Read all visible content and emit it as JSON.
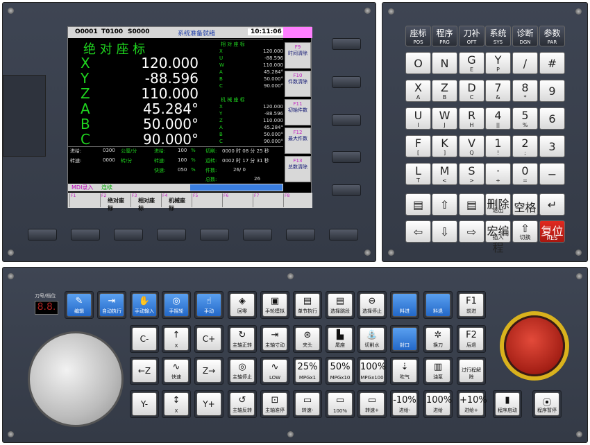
{
  "screen": {
    "program": "O0001",
    "tool": "T0100",
    "speed_cmd": "S0000",
    "status": "系统准备就绪",
    "time": "10:11:06",
    "abs_title": "绝 对 座 标",
    "axes": [
      {
        "name": "X",
        "value": "120.000"
      },
      {
        "name": "Y",
        "value": "-88.596"
      },
      {
        "name": "Z",
        "value": "110.000"
      },
      {
        "name": "A",
        "value": "45.284°"
      },
      {
        "name": "B",
        "value": "50.000°"
      },
      {
        "name": "C",
        "value": "90.000°"
      }
    ],
    "rel_title": "相 对 座 标",
    "rel": [
      {
        "name": "X",
        "value": "120.000"
      },
      {
        "name": "U",
        "value": "-88.596"
      },
      {
        "name": "W",
        "value": "110.000"
      },
      {
        "name": "A",
        "value": "45.284°"
      },
      {
        "name": "B",
        "value": "50.000°"
      },
      {
        "name": "C",
        "value": "90.000°"
      }
    ],
    "mach_title": "机 械 座 标",
    "mach": [
      {
        "name": "X",
        "value": "120.000"
      },
      {
        "name": "Y",
        "value": "-88.596"
      },
      {
        "name": "Z",
        "value": "110.000"
      },
      {
        "name": "A",
        "value": "45.284°"
      },
      {
        "name": "B",
        "value": "50.000°"
      },
      {
        "name": "C",
        "value": "90.000°"
      }
    ],
    "feed_label": "进给:",
    "feed_val": "0300",
    "feed_unit": "公厘/分",
    "feed_pct_label": "进给:",
    "feed_pct": "100",
    "rapid_label": "快速:",
    "rapid_pct": "050",
    "spin_label": "转速:",
    "spin_val": "0000",
    "spin_unit": "转/分",
    "spin_pct_label": "转速:",
    "spin_pct": "100",
    "cut_label": "切削:",
    "cut_time": "0000 时 08 分 25 秒",
    "run_label": "运转:",
    "run_time": "0002 时 17 分 31 秒",
    "parts_label": "件数:",
    "parts": "26/ 0",
    "total_label": "总数:",
    "total": "26",
    "mode": "MDI录入",
    "mode2": "连续",
    "fkeys": [
      {
        "n": "F9",
        "l": "时间清除"
      },
      {
        "n": "F10",
        "l": "件数清除"
      },
      {
        "n": "F11",
        "l": "初始件数"
      },
      {
        "n": "F12",
        "l": "最大件数"
      },
      {
        "n": "F13",
        "l": "总数清除"
      }
    ],
    "bottom_tabs": [
      {
        "n": "F1",
        "l": ""
      },
      {
        "n": "F2",
        "l": "绝对座标"
      },
      {
        "n": "F3",
        "l": "相对座标"
      },
      {
        "n": "F4",
        "l": "机械座标"
      },
      {
        "n": "F5",
        "l": ""
      },
      {
        "n": "F6",
        "l": ""
      },
      {
        "n": "F7",
        "l": ""
      },
      {
        "n": "F8",
        "l": ""
      }
    ]
  },
  "keypad": {
    "top": [
      {
        "a": "座标",
        "b": "POS"
      },
      {
        "a": "程序",
        "b": "PRG"
      },
      {
        "a": "刀补",
        "b": "OFT"
      },
      {
        "a": "系统",
        "b": "SYS"
      },
      {
        "a": "诊断",
        "b": "DGN"
      },
      {
        "a": "参数",
        "b": "PAR"
      }
    ],
    "rows": [
      [
        {
          "a": "O",
          "b": ""
        },
        {
          "a": "N",
          "b": ""
        },
        {
          "a": "G",
          "b": "E"
        },
        {
          "a": "Y",
          "b": "P"
        },
        {
          "a": "/",
          "b": ""
        },
        {
          "a": "#",
          "b": ""
        }
      ],
      [
        {
          "a": "X",
          "b": "A"
        },
        {
          "a": "Z",
          "b": "B"
        },
        {
          "a": "D",
          "b": "C"
        },
        {
          "a": "7",
          "b": "&"
        },
        {
          "a": "8",
          "b": "*"
        },
        {
          "a": "9",
          "b": ""
        }
      ],
      [
        {
          "a": "U",
          "b": "I"
        },
        {
          "a": "W",
          "b": "J"
        },
        {
          "a": "R",
          "b": "H"
        },
        {
          "a": "4",
          "b": "||"
        },
        {
          "a": "5",
          "b": "%"
        },
        {
          "a": "6",
          "b": ""
        }
      ],
      [
        {
          "a": "F",
          "b": "["
        },
        {
          "a": "K",
          "b": "]"
        },
        {
          "a": "V",
          "b": "Q"
        },
        {
          "a": "1",
          "b": "!"
        },
        {
          "a": "2",
          "b": ";"
        },
        {
          "a": "3",
          "b": ""
        }
      ],
      [
        {
          "a": "L",
          "b": "T"
        },
        {
          "a": "M",
          "b": "<"
        },
        {
          "a": "S",
          "b": ">"
        },
        {
          "a": "·",
          "b": "+"
        },
        {
          "a": "0",
          "b": "="
        },
        {
          "a": "−",
          "b": ""
        }
      ]
    ],
    "row6": [
      {
        "a": "▤",
        "b": ""
      },
      {
        "a": "⇧",
        "b": ""
      },
      {
        "a": "▤",
        "b": ""
      },
      {
        "a": "删除",
        "b": "退出"
      },
      {
        "a": "空格",
        "b": ""
      },
      {
        "a": "↵",
        "b": ""
      }
    ],
    "row7": [
      {
        "a": "⇦",
        "b": ""
      },
      {
        "a": "⇩",
        "b": ""
      },
      {
        "a": "⇨",
        "b": ""
      },
      {
        "a": "宏编程",
        "b": "插入"
      },
      {
        "a": "⇧",
        "b": "切换"
      },
      {
        "a": "复位",
        "b": "RES"
      }
    ]
  },
  "control": {
    "tool_label": "刀号/档位",
    "tool_display": "8.8.",
    "row1": [
      {
        "l": "编辑",
        "i": "✎"
      },
      {
        "l": "自动执行",
        "i": "⇥"
      },
      {
        "l": "手动输入",
        "i": "✋"
      },
      {
        "l": "手摇轮",
        "i": "◎"
      },
      {
        "l": "手动",
        "i": "☝"
      },
      {
        "l": "回零",
        "i": "◈"
      },
      {
        "l": "手轮模拟",
        "i": "▣"
      },
      {
        "l": "单节执行",
        "i": "▤"
      },
      {
        "l": "选择跳段",
        "i": "▤"
      },
      {
        "l": "选择停止",
        "i": "⊖"
      },
      {
        "l": "料进",
        "i": ""
      },
      {
        "l": "料退",
        "i": ""
      },
      {
        "l": "前进",
        "i": "F1"
      }
    ],
    "row2": [
      {
        "l": "",
        "i": "C-"
      },
      {
        "l": "X",
        "i": "↑"
      },
      {
        "l": "",
        "i": "C+"
      },
      {
        "l": "主轴正转",
        "i": "↻"
      },
      {
        "l": "主轴寸动",
        "i": "⇥"
      },
      {
        "l": "夹头",
        "i": "⊛"
      },
      {
        "l": "尾座",
        "i": "▙"
      },
      {
        "l": "切削水",
        "i": "⛲"
      },
      {
        "l": "封口",
        "i": ""
      },
      {
        "l": "换刀",
        "i": "✲"
      },
      {
        "l": "后退",
        "i": "F2"
      }
    ],
    "row3": [
      {
        "l": "",
        "i": "←Z"
      },
      {
        "l": "快速",
        "i": "∿"
      },
      {
        "l": "",
        "i": "Z→"
      },
      {
        "l": "主轴停止",
        "i": "◎"
      },
      {
        "l": "LOW",
        "i": "∿"
      },
      {
        "l": "MPGx1",
        "i": "25%"
      },
      {
        "l": "MPGx10",
        "i": "50%"
      },
      {
        "l": "MPGx100",
        "i": "100%"
      },
      {
        "l": "吹气",
        "i": "⇣"
      },
      {
        "l": "油泵",
        "i": "▥"
      },
      {
        "l": "过行程解除",
        "i": ""
      }
    ],
    "row4": [
      {
        "l": "",
        "i": "Y-"
      },
      {
        "l": "X",
        "i": "↕"
      },
      {
        "l": "",
        "i": "Y+"
      },
      {
        "l": "主轴反转",
        "i": "↺"
      },
      {
        "l": "主轴准停",
        "i": "⊡"
      },
      {
        "l": "转速-",
        "i": "▭"
      },
      {
        "l": "100%",
        "i": "▭"
      },
      {
        "l": "转速+",
        "i": "▭"
      },
      {
        "l": "进给-",
        "i": "-10%"
      },
      {
        "l": "进给",
        "i": "100%"
      },
      {
        "l": "进给+",
        "i": "+10%"
      },
      {
        "l": "程序启动",
        "i": "▮"
      },
      {
        "l": "程序暂停",
        "i": "⦿"
      }
    ]
  }
}
